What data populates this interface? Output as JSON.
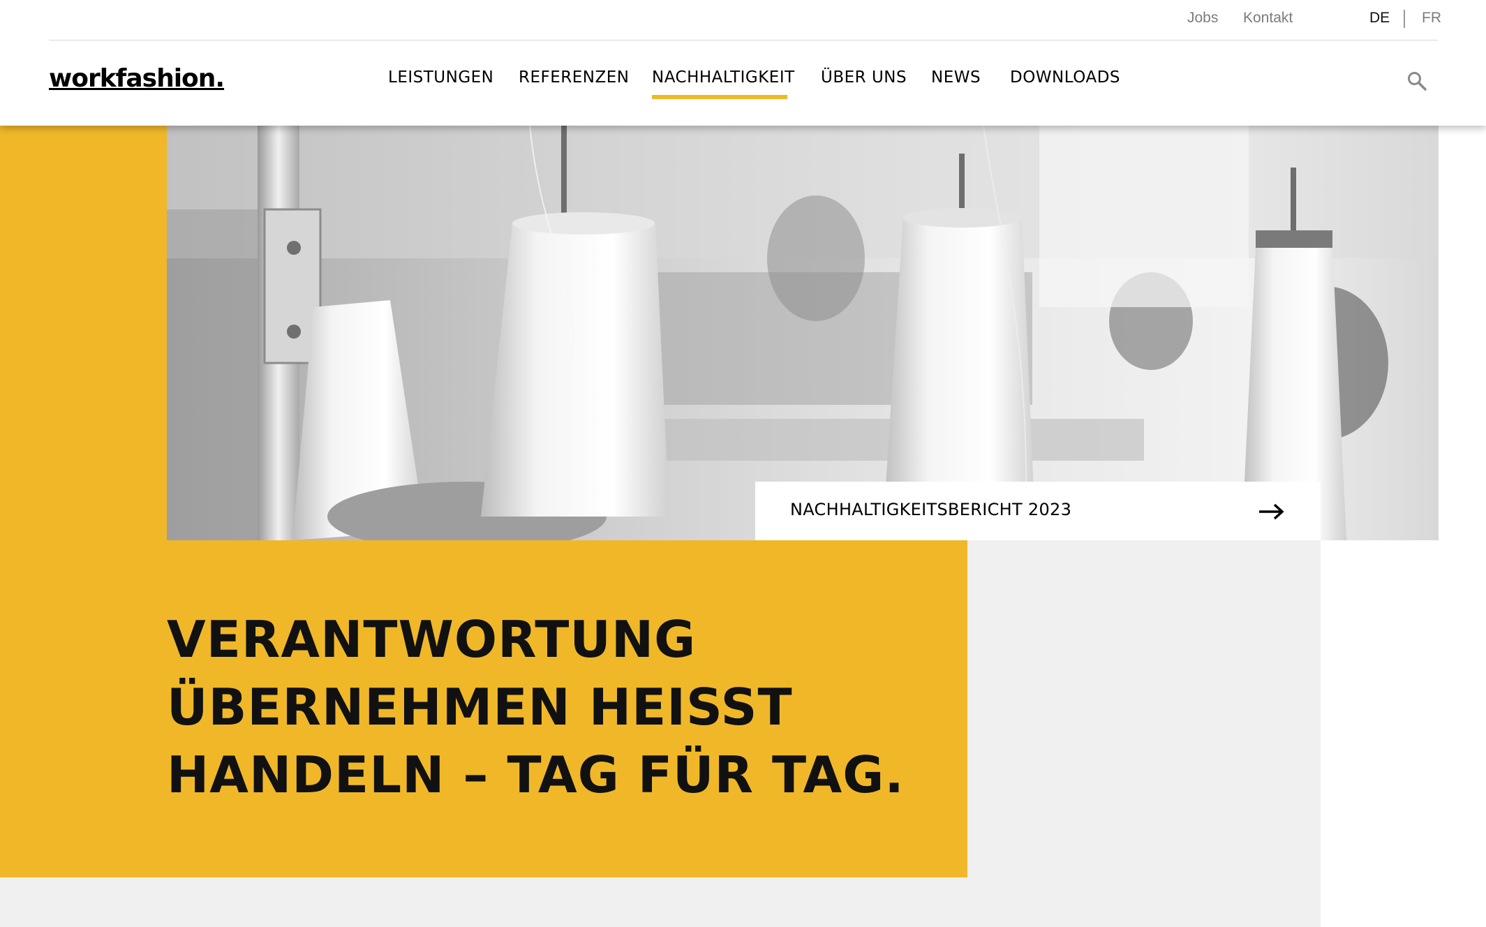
{
  "utility_nav": {
    "jobs": "Jobs",
    "kontakt": "Kontakt",
    "lang_de": "DE",
    "lang_fr": "FR"
  },
  "brand": {
    "logo": "workfashion."
  },
  "main_nav": {
    "items": [
      "LEISTUNGEN",
      "REFERENZEN",
      "NACHHALTIGKEIT",
      "ÜBER UNS",
      "NEWS",
      "DOWNLOADS"
    ],
    "active": "NACHHALTIGKEIT"
  },
  "hero": {
    "image_alt": "Garnspulen in einer Nähwerkstatt",
    "report_link": "NACHHALTIGKEITSBERICHT 2023"
  },
  "headline": {
    "lines": [
      "VERANTWORTUNG",
      "ÜBERNEHMEN HEISST",
      "HANDELN – TAG FÜR TAG."
    ]
  },
  "colors": {
    "accent": "#f0b829",
    "light_grey": "#eff0ef",
    "text": "#111111"
  },
  "icons": {
    "search": "search-icon",
    "arrow": "arrow-right-icon"
  }
}
